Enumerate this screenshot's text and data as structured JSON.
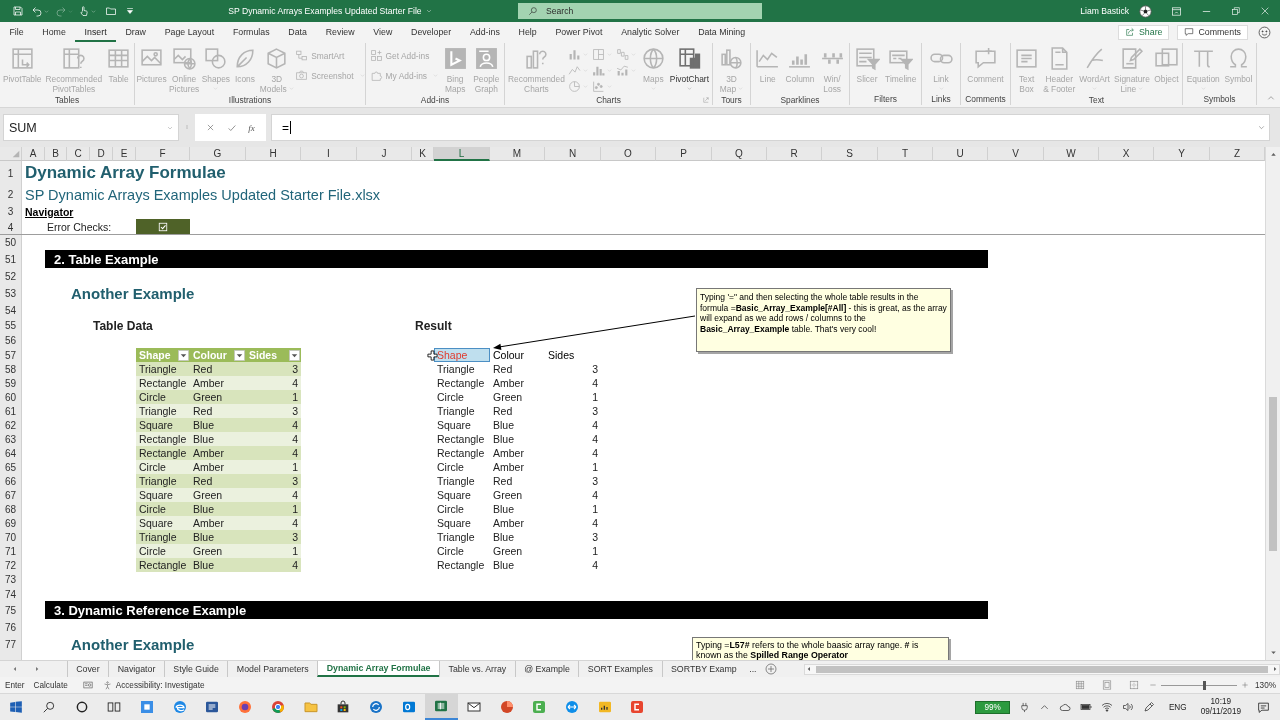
{
  "title_bar": {
    "title": "SP Dynamic Arrays Examples Updated Starter File",
    "search": {
      "placeholder": "Search"
    },
    "user": "Liam Bastick"
  },
  "menu": {
    "tabs": [
      {
        "label": "File",
        "selected": false
      },
      {
        "label": "Home",
        "selected": false
      },
      {
        "label": "Insert",
        "selected": true
      },
      {
        "label": "Draw",
        "selected": false
      },
      {
        "label": "Page Layout",
        "selected": false
      },
      {
        "label": "Formulas",
        "selected": false
      },
      {
        "label": "Data",
        "selected": false
      },
      {
        "label": "Review",
        "selected": false
      },
      {
        "label": "View",
        "selected": false
      },
      {
        "label": "Developer",
        "selected": false
      },
      {
        "label": "Add-ins",
        "selected": false
      },
      {
        "label": "Help",
        "selected": false
      },
      {
        "label": "Power Pivot",
        "selected": false
      },
      {
        "label": "Analytic Solver",
        "selected": false
      },
      {
        "label": "Data Mining",
        "selected": false
      }
    ],
    "share": "Share",
    "comments": "Comments"
  },
  "ribbon": [
    {
      "label": "Tables",
      "launcher": false,
      "items": [
        {
          "kind": "large",
          "label": "PivotTable",
          "disabled": true,
          "dropdown": false
        },
        {
          "kind": "large",
          "label": "Recommended\nPivotTables",
          "disabled": true,
          "dropdown": false
        },
        {
          "kind": "large",
          "label": "Table",
          "disabled": true,
          "dropdown": false
        }
      ]
    },
    {
      "label": "Illustrations",
      "launcher": false,
      "items": [
        {
          "kind": "large",
          "label": "Pictures",
          "disabled": true,
          "dropdown": false
        },
        {
          "kind": "large",
          "label": "Online\nPictures",
          "disabled": true,
          "dropdown": false
        },
        {
          "kind": "large",
          "label": "Shapes",
          "disabled": true,
          "dropdown": true
        },
        {
          "kind": "large",
          "label": "Icons",
          "disabled": true,
          "dropdown": false
        },
        {
          "kind": "large",
          "label": "3D\nModels",
          "disabled": true,
          "dropdown": true
        },
        {
          "kind": "stack",
          "items": [
            {
              "label": "SmartArt",
              "disabled": true,
              "dropdown": false
            },
            {
              "label": "Screenshot",
              "disabled": true,
              "dropdown": true
            }
          ]
        }
      ]
    },
    {
      "label": "Add-ins",
      "launcher": false,
      "items": [
        {
          "kind": "stack",
          "items": [
            {
              "label": "Get Add-ins",
              "disabled": true,
              "dropdown": false
            },
            {
              "label": "My Add-ins",
              "disabled": true,
              "dropdown": true
            }
          ]
        },
        {
          "kind": "large",
          "label": "Bing\nMaps",
          "disabled": true,
          "dropdown": false
        },
        {
          "kind": "large",
          "label": "People\nGraph",
          "disabled": true,
          "dropdown": false
        }
      ]
    },
    {
      "label": "Charts",
      "launcher": true,
      "items": [
        {
          "kind": "large",
          "label": "Recommended\nCharts",
          "disabled": true,
          "dropdown": false
        },
        {
          "kind": "gallery",
          "disabled": true
        },
        {
          "kind": "large",
          "label": "Maps",
          "disabled": true,
          "dropdown": true
        },
        {
          "kind": "large",
          "label": "PivotChart",
          "disabled": false,
          "dropdown": true
        }
      ]
    },
    {
      "label": "Tours",
      "launcher": false,
      "items": [
        {
          "kind": "large",
          "label": "3D\nMap",
          "disabled": true,
          "dropdown": true
        }
      ]
    },
    {
      "label": "Sparklines",
      "launcher": false,
      "items": [
        {
          "kind": "large",
          "label": "Line",
          "disabled": true,
          "dropdown": false
        },
        {
          "kind": "large",
          "label": "Column",
          "disabled": true,
          "dropdown": false
        },
        {
          "kind": "large",
          "label": "Win/\nLoss",
          "disabled": true,
          "dropdown": false
        }
      ]
    },
    {
      "label": "Filters",
      "launcher": false,
      "items": [
        {
          "kind": "large",
          "label": "Slicer",
          "disabled": true,
          "dropdown": false
        },
        {
          "kind": "large",
          "label": "Timeline",
          "disabled": true,
          "dropdown": false
        }
      ]
    },
    {
      "label": "Links",
      "launcher": false,
      "items": [
        {
          "kind": "large",
          "label": "Link",
          "disabled": true,
          "dropdown": true
        }
      ]
    },
    {
      "label": "Comments",
      "launcher": false,
      "items": [
        {
          "kind": "large",
          "label": "Comment",
          "disabled": true,
          "dropdown": false
        }
      ]
    },
    {
      "label": "Text",
      "launcher": false,
      "items": [
        {
          "kind": "large",
          "label": "Text\nBox",
          "disabled": true,
          "dropdown": false
        },
        {
          "kind": "large",
          "label": "Header\n& Footer",
          "disabled": true,
          "dropdown": false
        },
        {
          "kind": "large",
          "label": "WordArt",
          "disabled": true,
          "dropdown": true
        },
        {
          "kind": "large",
          "label": "Signature\nLine",
          "disabled": true,
          "dropdown": true
        },
        {
          "kind": "large",
          "label": "Object",
          "disabled": true,
          "dropdown": false
        }
      ]
    },
    {
      "label": "Symbols",
      "launcher": false,
      "items": [
        {
          "kind": "large",
          "label": "Equation",
          "disabled": true,
          "dropdown": true
        },
        {
          "kind": "large",
          "label": "Symbol",
          "disabled": true,
          "dropdown": false
        }
      ]
    }
  ],
  "formula_bar": {
    "name_box": "SUM",
    "function_button": "fx",
    "formula": "="
  },
  "sheet": {
    "columns": [
      {
        "label": "A",
        "selected": false
      },
      {
        "label": "B",
        "selected": false
      },
      {
        "label": "C",
        "selected": false
      },
      {
        "label": "D",
        "selected": false
      },
      {
        "label": "E",
        "selected": false
      },
      {
        "label": "F",
        "selected": false
      },
      {
        "label": "G",
        "selected": false
      },
      {
        "label": "H",
        "selected": false
      },
      {
        "label": "I",
        "selected": false
      },
      {
        "label": "J",
        "selected": false
      },
      {
        "label": "K",
        "selected": false
      },
      {
        "label": "L",
        "selected": true
      },
      {
        "label": "M",
        "selected": false
      },
      {
        "label": "N",
        "selected": false
      },
      {
        "label": "O",
        "selected": false
      },
      {
        "label": "P",
        "selected": false
      },
      {
        "label": "Q",
        "selected": false
      },
      {
        "label": "R",
        "selected": false
      },
      {
        "label": "S",
        "selected": false
      },
      {
        "label": "T",
        "selected": false
      },
      {
        "label": "U",
        "selected": false
      },
      {
        "label": "V",
        "selected": false
      },
      {
        "label": "W",
        "selected": false
      },
      {
        "label": "X",
        "selected": false
      },
      {
        "label": "Y",
        "selected": false
      },
      {
        "label": "Z",
        "selected": false
      }
    ],
    "rows": [
      "1",
      "2",
      "3",
      "4",
      "50",
      "51",
      "52",
      "53",
      "54",
      "55",
      "56",
      "57",
      "58",
      "59",
      "60",
      "61",
      "62",
      "63",
      "64",
      "65",
      "66",
      "67",
      "68",
      "69",
      "70",
      "71",
      "72",
      "73",
      "74",
      "75",
      "76",
      "77"
    ],
    "title": "Dynamic Array Formulae",
    "subtitle": "SP Dynamic Arrays Examples Updated Starter File.xlsx",
    "navigator": "Navigator",
    "error_checks": {
      "label": "Error Checks:",
      "checked": true
    },
    "sections": [
      {
        "heading": "2. Table Example",
        "subheading": "Another Example",
        "table_title": "Table Data",
        "result_title": "Result",
        "table": {
          "columns": [
            "Shape",
            "Colour",
            "Sides"
          ],
          "rows": [
            [
              "Triangle",
              "Red",
              "3"
            ],
            [
              "Rectangle",
              "Amber",
              "4"
            ],
            [
              "Circle",
              "Green",
              "1"
            ],
            [
              "Triangle",
              "Red",
              "3"
            ],
            [
              "Square",
              "Blue",
              "4"
            ],
            [
              "Rectangle",
              "Blue",
              "4"
            ],
            [
              "Rectangle",
              "Amber",
              "4"
            ],
            [
              "Circle",
              "Amber",
              "1"
            ],
            [
              "Triangle",
              "Red",
              "3"
            ],
            [
              "Square",
              "Green",
              "4"
            ],
            [
              "Circle",
              "Blue",
              "1"
            ],
            [
              "Square",
              "Amber",
              "4"
            ],
            [
              "Triangle",
              "Blue",
              "3"
            ],
            [
              "Circle",
              "Green",
              "1"
            ],
            [
              "Rectangle",
              "Blue",
              "4"
            ]
          ]
        },
        "result": {
          "columns": [
            {
              "label": "Shape",
              "selected": true
            },
            {
              "label": "Colour",
              "selected": false
            },
            {
              "label": "Sides",
              "selected": false
            }
          ],
          "rows": [
            [
              "Triangle",
              "Red",
              "3"
            ],
            [
              "Rectangle",
              "Amber",
              "4"
            ],
            [
              "Circle",
              "Green",
              "1"
            ],
            [
              "Triangle",
              "Red",
              "3"
            ],
            [
              "Square",
              "Blue",
              "4"
            ],
            [
              "Rectangle",
              "Blue",
              "4"
            ],
            [
              "Rectangle",
              "Amber",
              "4"
            ],
            [
              "Circle",
              "Amber",
              "1"
            ],
            [
              "Triangle",
              "Red",
              "3"
            ],
            [
              "Square",
              "Green",
              "4"
            ],
            [
              "Circle",
              "Blue",
              "1"
            ],
            [
              "Square",
              "Amber",
              "4"
            ],
            [
              "Triangle",
              "Blue",
              "3"
            ],
            [
              "Circle",
              "Green",
              "1"
            ],
            [
              "Rectangle",
              "Blue",
              "4"
            ]
          ]
        },
        "note": "Typing '=\" and then selecting the whole table results in the formula =**Basic_Array_Example[#All]** - this is great, as the array will expand as we add rows / columns to the **Basic_Array_Example** table.  That's very cool!"
      },
      {
        "heading": "3. Dynamic Reference Example",
        "subheading": "Another Example",
        "note": "Typing =**L57#** refers to the whole baasic array range.  **#** is known as the **Spilled Range Operator**"
      }
    ]
  },
  "sheet_tabs": {
    "tabs": [
      {
        "label": "Cover",
        "selected": false
      },
      {
        "label": "Navigator",
        "selected": false
      },
      {
        "label": "Style Guide",
        "selected": false
      },
      {
        "label": "Model Parameters",
        "selected": false
      },
      {
        "label": "Dynamic Array Formulae",
        "selected": true
      },
      {
        "label": "Table vs. Array",
        "selected": false
      },
      {
        "label": "@ Example",
        "selected": false
      },
      {
        "label": "SORT Examples",
        "selected": false
      },
      {
        "label": "SORTBY Examp",
        "selected": false
      }
    ],
    "more": "..."
  },
  "status_bar": {
    "mode": "Enter",
    "calculate": "Calculate",
    "accessibility": "Accessibility: Investigate",
    "zoom": {
      "label": "130%",
      "level": 0.56
    }
  },
  "taskbar": {
    "apps": [
      {
        "selected": false
      },
      {
        "selected": false
      },
      {
        "selected": false
      },
      {
        "selected": false
      },
      {
        "selected": false
      },
      {
        "selected": false
      },
      {
        "selected": false
      },
      {
        "selected": false
      },
      {
        "selected": false
      },
      {
        "selected": true
      },
      {
        "selected": false
      },
      {
        "selected": false
      },
      {
        "selected": false
      },
      {
        "selected": false
      },
      {
        "selected": false
      },
      {
        "selected": false
      }
    ],
    "battery": "99%",
    "language": "ENG",
    "time": "10:19",
    "date": "09/11/2019"
  }
}
